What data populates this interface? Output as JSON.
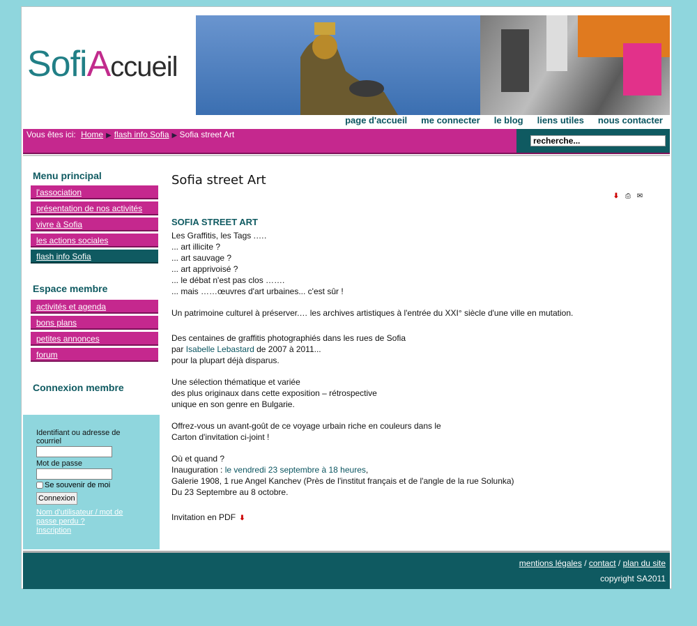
{
  "logo": {
    "part1": "Sofi",
    "part2": "A",
    "part3": "ccueil"
  },
  "topnav": [
    "page d'accueil",
    "me connecter",
    "le blog",
    "liens utiles",
    "nous contacter"
  ],
  "breadcrumb": {
    "label": "Vous êtes ici:",
    "home": "Home",
    "section": "flash info Sofia",
    "current": "Sofia street Art"
  },
  "search": {
    "value": "recherche..."
  },
  "sidebar": {
    "main_title": "Menu principal",
    "main_items": [
      "l'association",
      "présentation de nos activités",
      "vivre à Sofia",
      "les actions sociales",
      "flash info Sofia"
    ],
    "member_title": "Espace membre",
    "member_items": [
      "activités et agenda",
      "bons plans",
      "petites annonces",
      "forum"
    ],
    "login_title": "Connexion membre",
    "login": {
      "user_label": "Identifiant ou adresse de courriel",
      "pass_label": "Mot de passe",
      "remember": "Se souvenir de moi",
      "submit": "Connexion",
      "forgot": "Nom d'utilisateur / mot de passe perdu ?",
      "register": "Inscription"
    }
  },
  "article": {
    "title": "Sofia street Art",
    "heading": "SOFIA STREET ART",
    "p1": [
      "Les Graffitis, les Tags .….",
      "... art illicite ?",
      "... art sauvage ?",
      "... art apprivoisé ?",
      "... le débat n'est pas clos …….",
      "... mais ……œuvres d'art urbaines... c'est sûr !"
    ],
    "p2": "Un patrimoine culturel à préserver.… les archives artistiques à l'entrée du XXI° siècle d'une ville en mutation.",
    "p3_line1": "Des centaines de graffitis photographiés dans les rues de Sofia",
    "p3_par": "par",
    "p3_author": "Isabelle Lebastard",
    "p3_years": "de 2007 à 2011...",
    "p3_line3": "pour la plupart déjà disparus.",
    "p4": [
      "Une sélection thématique et variée",
      "des plus originaux dans cette exposition – rétrospective",
      "unique en son genre en Bulgarie."
    ],
    "p5": [
      "Offrez-vous un avant-goût de ce voyage urbain riche en couleurs dans le",
      "Carton d'invitation ci-joint !"
    ],
    "p6_q": "Où et quand ?",
    "p6_inaug": "Inauguration :",
    "p6_date": "le vendredi 23 septembre à 18 heures",
    "p6_comma": ",",
    "p6_place": "Galerie 1908, 1 rue Angel Kanchev  (Près de l'institut français et de l'angle de la rue Solunka)",
    "p6_period": "Du 23 Septembre au 8 octobre.",
    "pdf_label": "Invitation en PDF"
  },
  "footer": {
    "legal": "mentions légales",
    "sep": "/",
    "contact": "contact",
    "sitemap": "plan du site",
    "copyright": "copyright SA2011"
  }
}
